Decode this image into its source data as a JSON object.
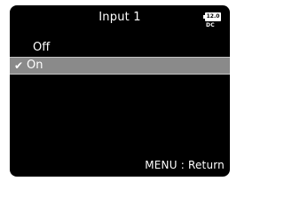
{
  "header": {
    "title": "Input 1",
    "battery_level": "12.0",
    "power_source": "DC"
  },
  "menu": {
    "items": [
      {
        "label": "Off",
        "selected": false
      },
      {
        "label": "On",
        "selected": true
      }
    ],
    "check_glyph": "✔"
  },
  "footer": {
    "hint": "MENU : Return"
  },
  "colors": {
    "screen_bg": "#000000",
    "highlight_bg": "#8a8a8a",
    "text": "#ffffff"
  }
}
